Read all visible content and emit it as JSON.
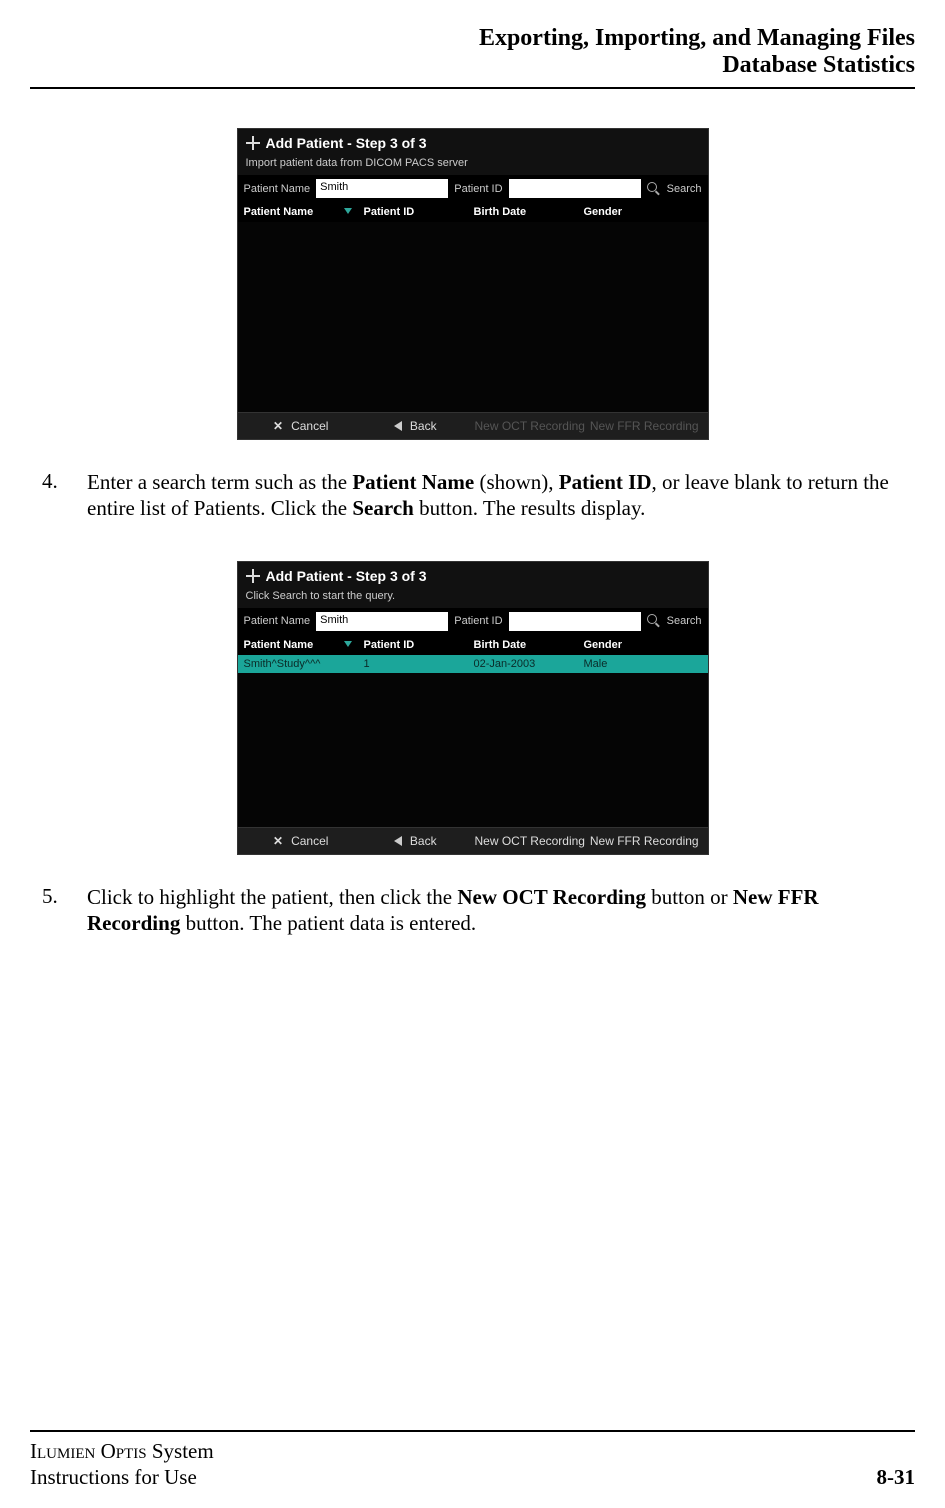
{
  "header": {
    "line1": "Exporting, Importing, and Managing Files",
    "line2": "Database Statistics"
  },
  "shot1": {
    "title": "Add Patient - Step 3 of 3",
    "subtitle": "Import patient data from DICOM PACS server",
    "labels": {
      "patientName": "Patient Name",
      "patientId": "Patient ID",
      "search": "Search"
    },
    "values": {
      "name": "Smith",
      "id": ""
    },
    "cols": [
      "Patient Name",
      "Patient ID",
      "Birth Date",
      "Gender"
    ],
    "footer": {
      "cancel": "Cancel",
      "back": "Back",
      "newOct": "New OCT Recording",
      "newFfr": "New FFR Recording"
    }
  },
  "step4": {
    "num": "4.",
    "text_a": "Enter a search term such as the ",
    "b1": "Patient Name",
    "text_b": " (shown), ",
    "b2": "Patient ID",
    "text_c": ", or leave blank to return the entire list of Patients. Click the ",
    "b3": "Search",
    "text_d": " button. The results display."
  },
  "shot2": {
    "title": "Add Patient - Step 3 of 3",
    "subtitle": "Click Search to start the query.",
    "labels": {
      "patientName": "Patient Name",
      "patientId": "Patient ID",
      "search": "Search"
    },
    "values": {
      "name": "Smith",
      "id": ""
    },
    "cols": [
      "Patient Name",
      "Patient ID",
      "Birth Date",
      "Gender"
    ],
    "row": {
      "name": "Smith^Study^^^",
      "id": "1",
      "dob": "02-Jan-2003",
      "gender": "Male"
    },
    "footer": {
      "cancel": "Cancel",
      "back": "Back",
      "newOct": "New OCT Recording",
      "newFfr": "New FFR Recording"
    }
  },
  "step5": {
    "num": "5.",
    "text_a": "Click to highlight the patient, then click the ",
    "b1": "New OCT Recording",
    "text_b": " button or ",
    "b2": "New FFR Recording",
    "text_c": " button. The patient data is entered."
  },
  "footer": {
    "product_sc1": "Ilumien",
    "product_sc2": "Optis",
    "product_tail": " System",
    "doc": "Instructions for Use",
    "page": "8-31"
  }
}
